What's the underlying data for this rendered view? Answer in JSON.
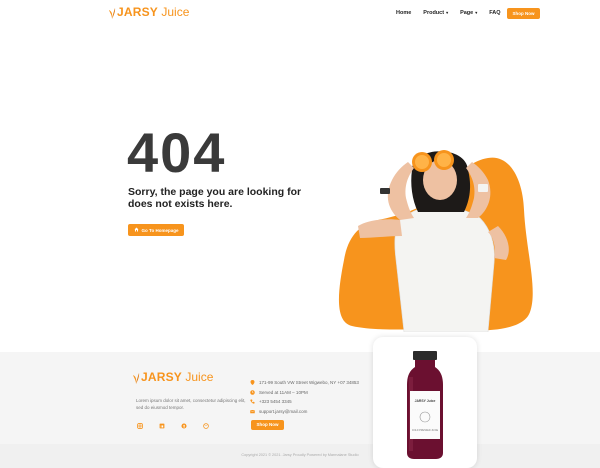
{
  "brand": {
    "name_bold": "JARSY",
    "name_light": " Juice",
    "accent_color": "#f7941d"
  },
  "nav": {
    "items": [
      {
        "label": "Home",
        "has_dropdown": false
      },
      {
        "label": "Product",
        "has_dropdown": true
      },
      {
        "label": "Page",
        "has_dropdown": true
      },
      {
        "label": "FAQ",
        "has_dropdown": false
      }
    ],
    "shop_button": "Shop Now"
  },
  "error": {
    "code": "404",
    "message": "Sorry, the page you are looking for does not exists here.",
    "home_button": "Go To Homepage"
  },
  "footer": {
    "description": "Lorem ipsum dolor sit amet, consectetur adipiscing elit, sed do eiusmod tempor.",
    "social_icons": [
      "instagram-icon",
      "linkedin-icon",
      "facebook-icon",
      "dribbble-icon"
    ],
    "contacts": [
      {
        "icon": "location-icon",
        "text": "171-99 South VW Street Wigwebo, NY +07 34853"
      },
      {
        "icon": "clock-icon",
        "text": "Served at 11AM – 10PM"
      },
      {
        "icon": "phone-icon",
        "text": "+323 5454 3345"
      },
      {
        "icon": "mail-icon",
        "text": "support.jarsy@mail.com"
      }
    ],
    "shop_button": "Shop Now",
    "copyright": "Copyright 2021 © 2021. Jarsy Proudly Powered by Marmalane Studio"
  },
  "product_card": {
    "bottle_label_brand": "JARSY Juice",
    "bottle_label_flavor": "COLD PRESSED JUICE"
  }
}
